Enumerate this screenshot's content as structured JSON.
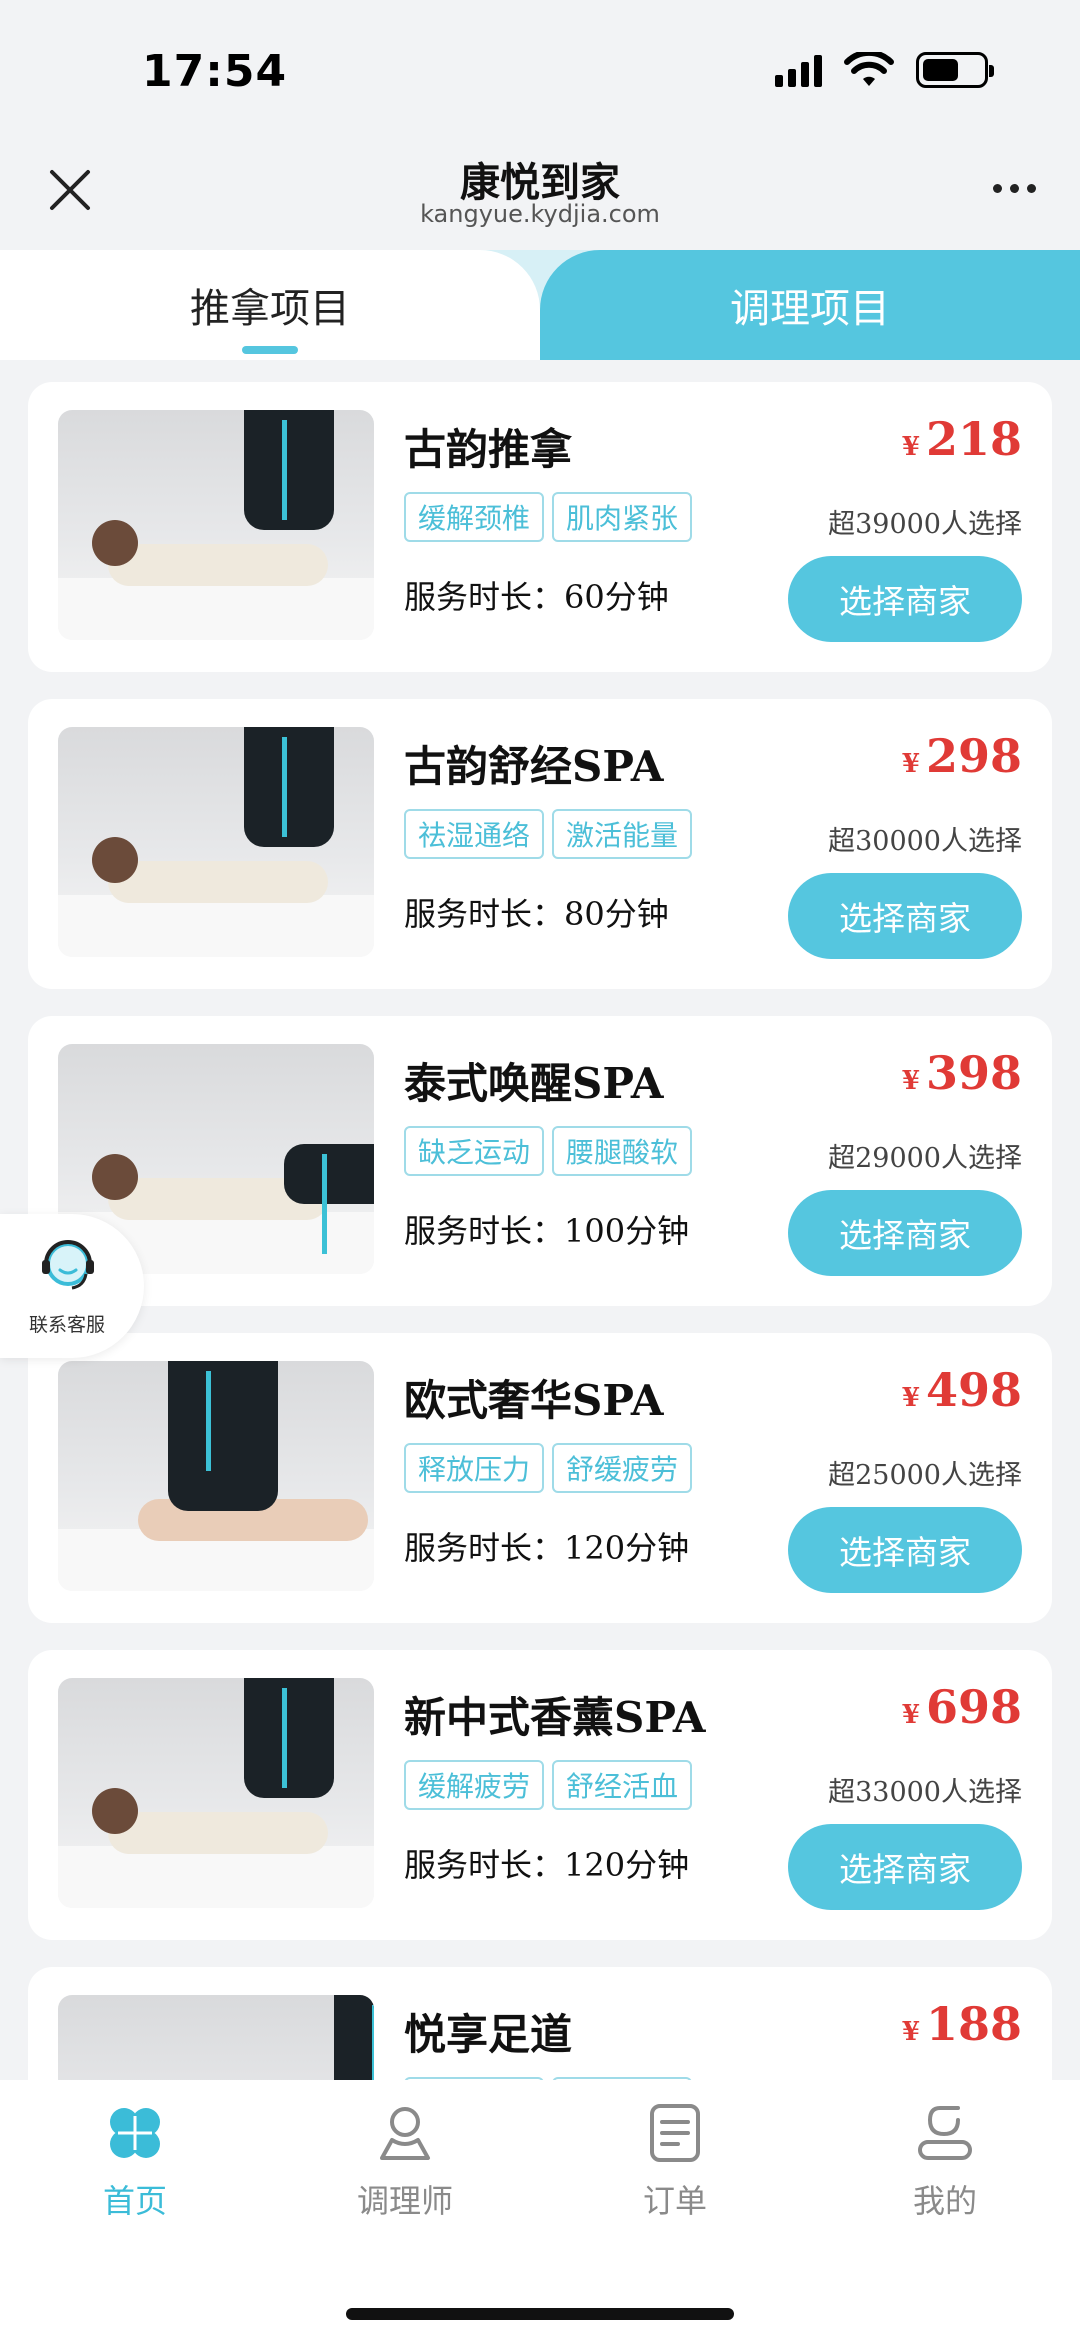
{
  "status_bar": {
    "time": "17:54",
    "battery_level": 0.6
  },
  "nav": {
    "title": "康悦到家",
    "url": "kangyue.kydjia.com"
  },
  "tabs": [
    {
      "label": "推拿项目",
      "active": true
    },
    {
      "label": "调理项目",
      "active": false
    }
  ],
  "services": [
    {
      "name": "古韵推拿",
      "tags": [
        "缓解颈椎",
        "肌肉紧张"
      ],
      "duration": "服务时长：60分钟",
      "currency": "¥",
      "price": "218",
      "sales": "超39000人选择",
      "button": "选择商家"
    },
    {
      "name": "古韵舒经SPA",
      "tags": [
        "祛湿通络",
        "激活能量"
      ],
      "duration": "服务时长：80分钟",
      "currency": "¥",
      "price": "298",
      "sales": "超30000人选择",
      "button": "选择商家"
    },
    {
      "name": "泰式唤醒SPA",
      "tags": [
        "缺乏运动",
        "腰腿酸软"
      ],
      "duration": "服务时长：100分钟",
      "currency": "¥",
      "price": "398",
      "sales": "超29000人选择",
      "button": "选择商家"
    },
    {
      "name": "欧式奢华SPA",
      "tags": [
        "释放压力",
        "舒缓疲劳"
      ],
      "duration": "服务时长：120分钟",
      "currency": "¥",
      "price": "498",
      "sales": "超25000人选择",
      "button": "选择商家"
    },
    {
      "name": "新中式香薰SPA",
      "tags": [
        "缓解疲劳",
        "舒经活血"
      ],
      "duration": "服务时长：120分钟",
      "currency": "¥",
      "price": "698",
      "sales": "超33000人选择",
      "button": "选择商家"
    },
    {
      "name": "悦享足道",
      "tags": [
        "",
        ""
      ],
      "duration": "",
      "currency": "¥",
      "price": "188",
      "sales": "",
      "button": ""
    }
  ],
  "customer_service": {
    "label": "联系客服",
    "icon": "headset-icon"
  },
  "bottom_nav": [
    {
      "label": "首页",
      "icon": "clover-icon",
      "active": true
    },
    {
      "label": "调理师",
      "icon": "therapist-icon",
      "active": false
    },
    {
      "label": "订单",
      "icon": "order-icon",
      "active": false
    },
    {
      "label": "我的",
      "icon": "profile-icon",
      "active": false
    }
  ],
  "colors": {
    "accent": "#55c6df",
    "price": "#e03a36",
    "background": "#f2f3f5"
  }
}
